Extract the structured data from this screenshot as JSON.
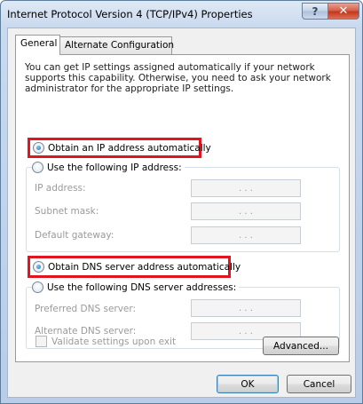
{
  "window": {
    "title": "Internet Protocol Version 4 (TCP/IPv4) Properties",
    "help_label": "?",
    "close_label": "✕"
  },
  "tabs": [
    {
      "label": "General",
      "selected": true
    },
    {
      "label": "Alternate Configuration",
      "selected": false
    }
  ],
  "intro_text": "You can get IP settings assigned automatically if your network supports this capability. Otherwise, you need to ask your network administrator for the appropriate IP settings.",
  "ip_section": {
    "auto_label": "Obtain an IP address automatically",
    "auto_selected": true,
    "manual_label": "Use the following IP address:",
    "fields": [
      {
        "label": "IP address:",
        "value": ".   .   ."
      },
      {
        "label": "Subnet mask:",
        "value": ".   .   ."
      },
      {
        "label": "Default gateway:",
        "value": ".   .   ."
      }
    ]
  },
  "dns_section": {
    "auto_label": "Obtain DNS server address automatically",
    "auto_selected": true,
    "manual_label": "Use the following DNS server addresses:",
    "fields": [
      {
        "label": "Preferred DNS server:",
        "value": ".   .   ."
      },
      {
        "label": "Alternate DNS server:",
        "value": ".   .   ."
      }
    ]
  },
  "validate_label": "Validate settings upon exit",
  "buttons": {
    "advanced": "Advanced...",
    "ok": "OK",
    "cancel": "Cancel"
  },
  "colors": {
    "highlight": "#e2141f",
    "close_button": "#c2371e"
  }
}
